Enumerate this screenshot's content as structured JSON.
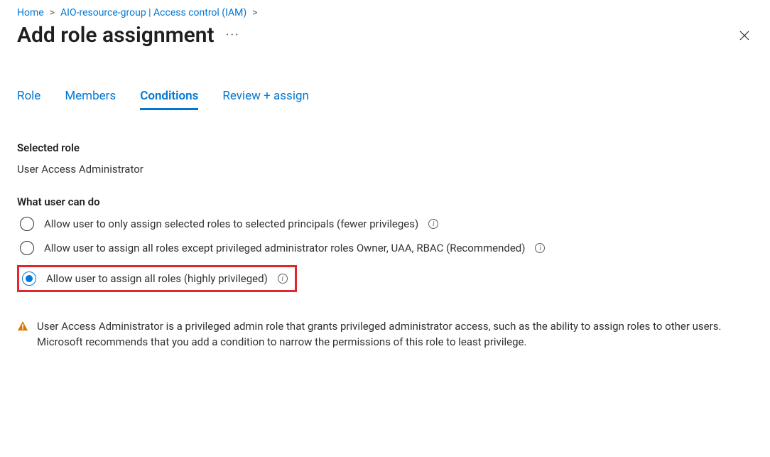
{
  "breadcrumb": {
    "home": "Home",
    "resource": "AIO-resource-group | Access control (IAM)"
  },
  "page_title": "Add role assignment",
  "tabs": {
    "role": "Role",
    "members": "Members",
    "conditions": "Conditions",
    "review": "Review + assign"
  },
  "selected_role": {
    "label": "Selected role",
    "value": "User Access Administrator"
  },
  "what_user_can_do": {
    "label": "What user can do",
    "options": {
      "opt1": "Allow user to only assign selected roles to selected principals (fewer privileges)",
      "opt2": "Allow user to assign all roles except privileged administrator roles Owner, UAA, RBAC (Recommended)",
      "opt3": "Allow user to assign all roles (highly privileged)"
    }
  },
  "warning_text": "User Access Administrator is a privileged admin role that grants privileged administrator access, such as the ability to assign roles to other users. Microsoft recommends that you add a condition to narrow the permissions of this role to least privilege."
}
